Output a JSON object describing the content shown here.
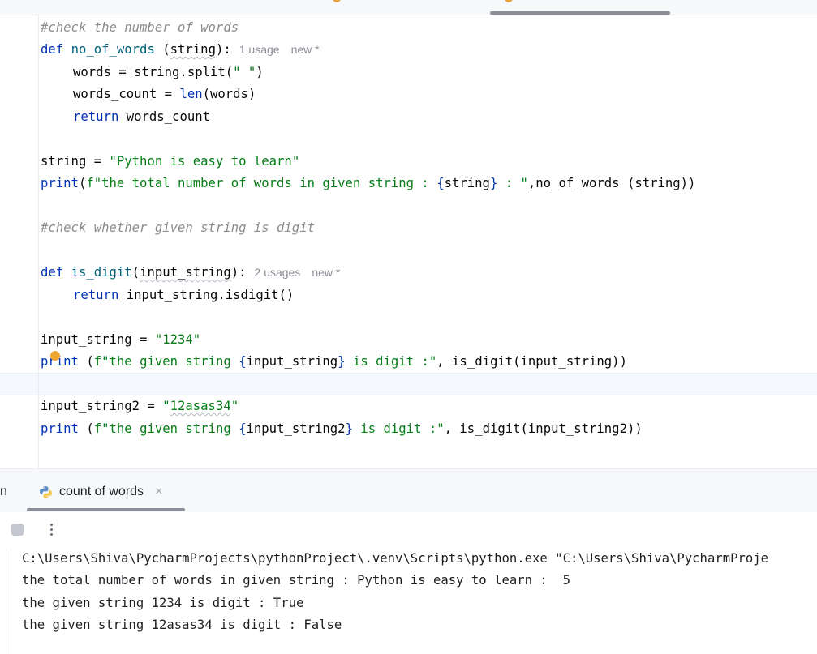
{
  "editor": {
    "lines": {
      "l1": {
        "comment": "#check the number of words"
      },
      "l2": {
        "kw": "def",
        "name": "no_of_words",
        "param": "string",
        "tail": "):",
        "hint_usage": "1 usage",
        "hint_new": "new *"
      },
      "l3": {
        "lhs": "words = string.split(",
        "arg": "\" \"",
        "close": ")"
      },
      "l4": {
        "lhs": "words_count = ",
        "fn": "len",
        "rest": "(words)"
      },
      "l5": {
        "kw": "return",
        "rest": " words_count"
      },
      "l7": {
        "lhs": "string = ",
        "value": "\"Python is easy to learn\""
      },
      "l8": {
        "fn": "print",
        "open": "(",
        "fstr1": "f\"the total number of words in given string : ",
        "expr": "string",
        "fstr2": " : \"",
        "rest": ",no_of_words (string))"
      },
      "l10": {
        "comment": "#check whether given string is digit"
      },
      "l12": {
        "kw": "def",
        "name": "is_digit",
        "param": "input_string",
        "tail": "):",
        "hint_usage": "2 usages",
        "hint_new": "new *"
      },
      "l13": {
        "kw": "return",
        "rest": " input_string.isdigit()"
      },
      "l15": {
        "lhs": "input_string = ",
        "value": "\"1234\""
      },
      "l16": {
        "fn": "print",
        "open": " (",
        "fstr1": "f\"the given string ",
        "expr": "input_string",
        "fstr2": " is digit :\"",
        "rest": ", is_digit(input_string))"
      },
      "l18": {
        "lhs": "input_string2 = ",
        "v1": "\"",
        "v2": "12asas34",
        "v3": "\""
      },
      "l19": {
        "fn": "print",
        "open": " (",
        "fstr1": "f\"the given string ",
        "expr": "input_string2",
        "fstr2": " is digit :\"",
        "rest": ", is_digit(input_string2))"
      }
    }
  },
  "run_panel": {
    "run_label_fragment": "n",
    "tab_title": "count of words",
    "close_glyph": "×",
    "more_glyph": "⋮"
  },
  "console": {
    "lines": [
      "C:\\Users\\Shiva\\PycharmProjects\\pythonProject\\.venv\\Scripts\\python.exe \"C:\\Users\\Shiva\\PycharmProje",
      "the total number of words in given string : Python is easy to learn :  5",
      "the given string 1234 is digit : True",
      "the given string 12asas34 is digit : False"
    ]
  },
  "colors": {
    "keyword": "#0033b3",
    "function": "#00627a",
    "string": "#067d17",
    "comment": "#8c8c8c",
    "caret_line": "#f5f8fe",
    "intention_bulb": "#f0a732"
  }
}
